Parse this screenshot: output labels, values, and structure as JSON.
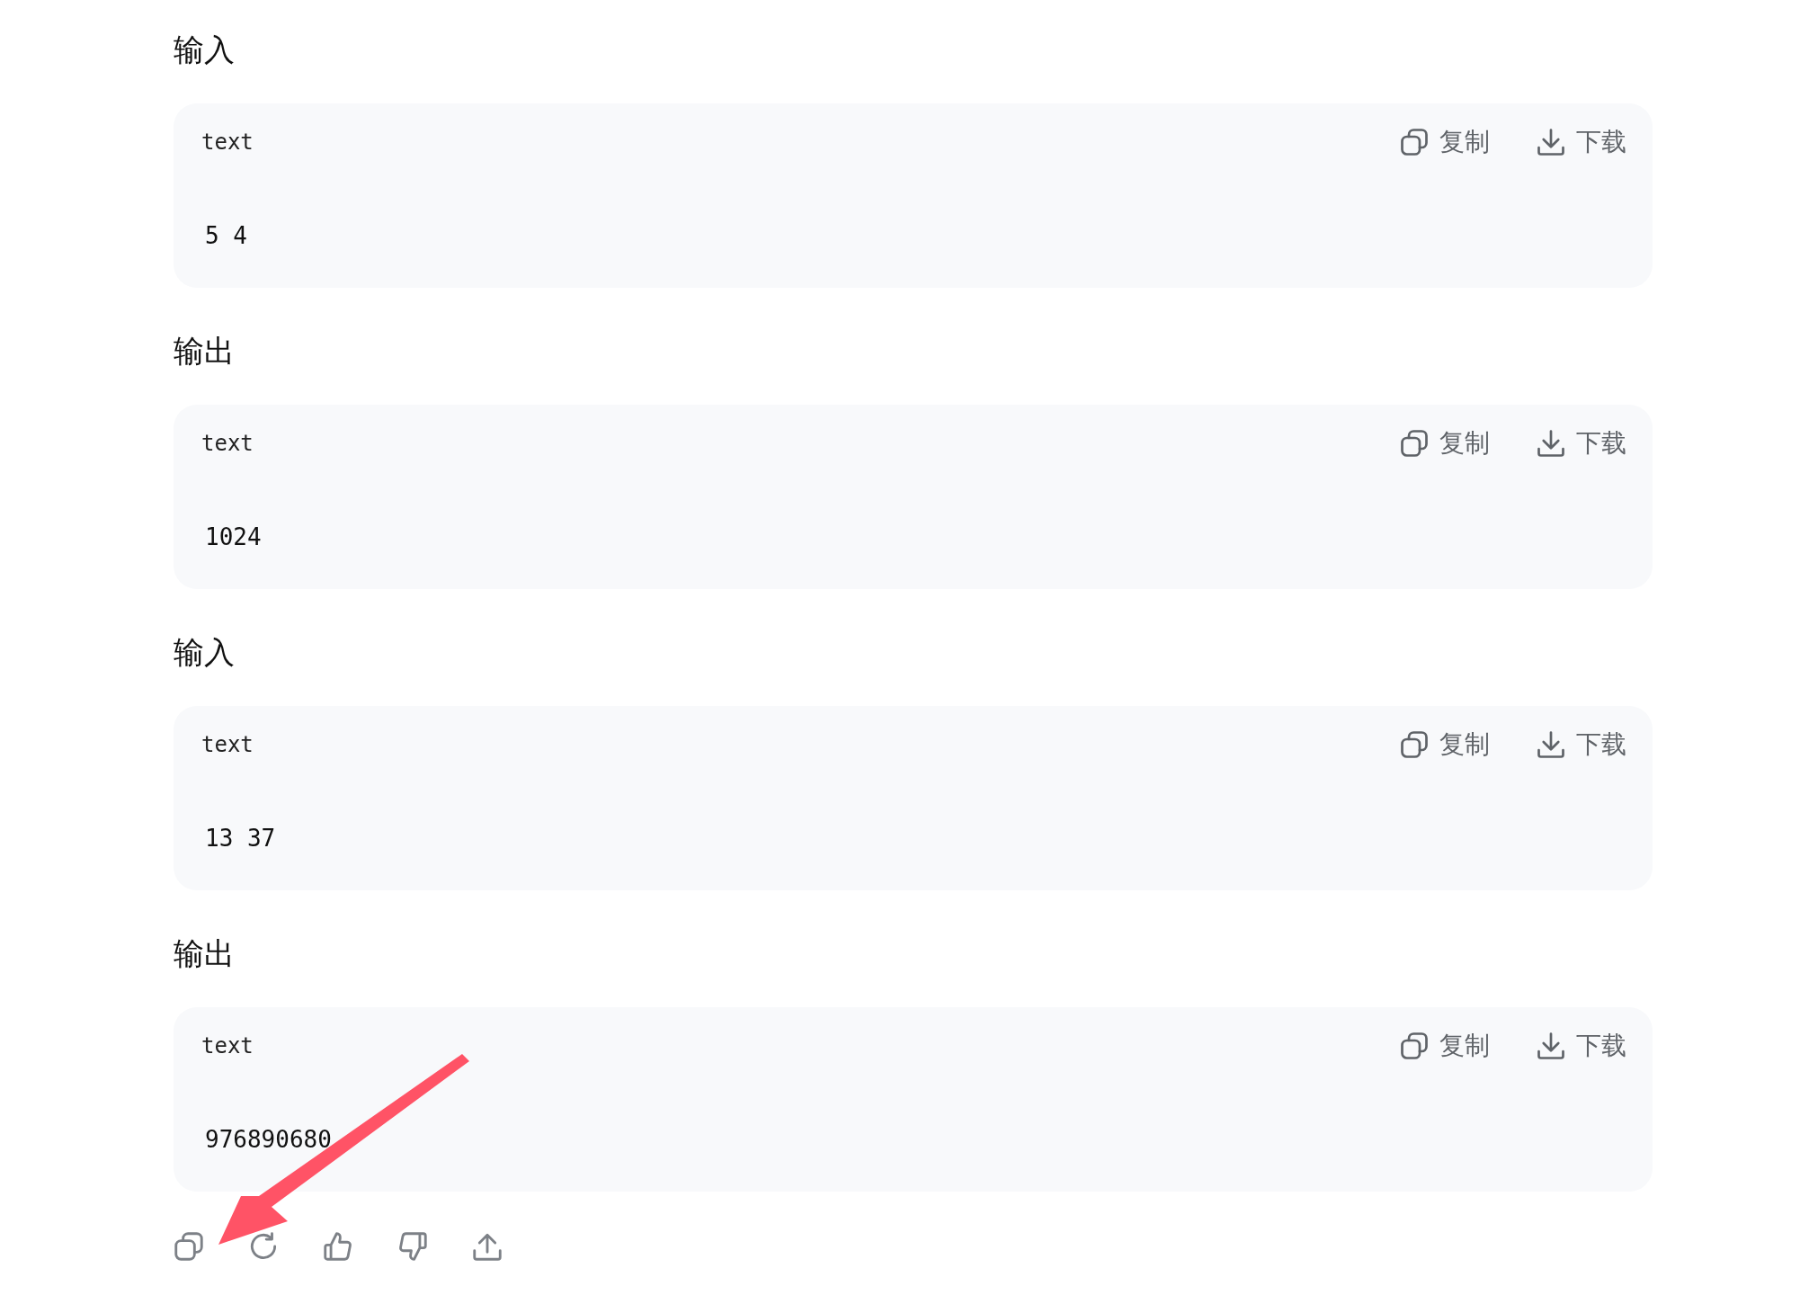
{
  "sections": [
    {
      "heading": "输入",
      "code": {
        "language": "text",
        "content": "5 4",
        "actions": [
          {
            "kind": "copy",
            "label": "复制"
          },
          {
            "kind": "download",
            "label": "下载"
          }
        ]
      }
    },
    {
      "heading": "输出",
      "code": {
        "language": "text",
        "content": "1024",
        "actions": [
          {
            "kind": "copy",
            "label": "复制"
          },
          {
            "kind": "download",
            "label": "下载"
          }
        ]
      }
    },
    {
      "heading": "输入",
      "code": {
        "language": "text",
        "content": "13 37",
        "actions": [
          {
            "kind": "copy",
            "label": "复制"
          },
          {
            "kind": "download",
            "label": "下载"
          }
        ]
      }
    },
    {
      "heading": "输出",
      "code": {
        "language": "text",
        "content": "976890680",
        "actions": [
          {
            "kind": "copy",
            "label": "复制"
          },
          {
            "kind": "download",
            "label": "下载"
          }
        ]
      }
    }
  ],
  "message_actions": [
    {
      "kind": "copy"
    },
    {
      "kind": "regenerate"
    },
    {
      "kind": "like"
    },
    {
      "kind": "dislike"
    },
    {
      "kind": "share"
    }
  ]
}
